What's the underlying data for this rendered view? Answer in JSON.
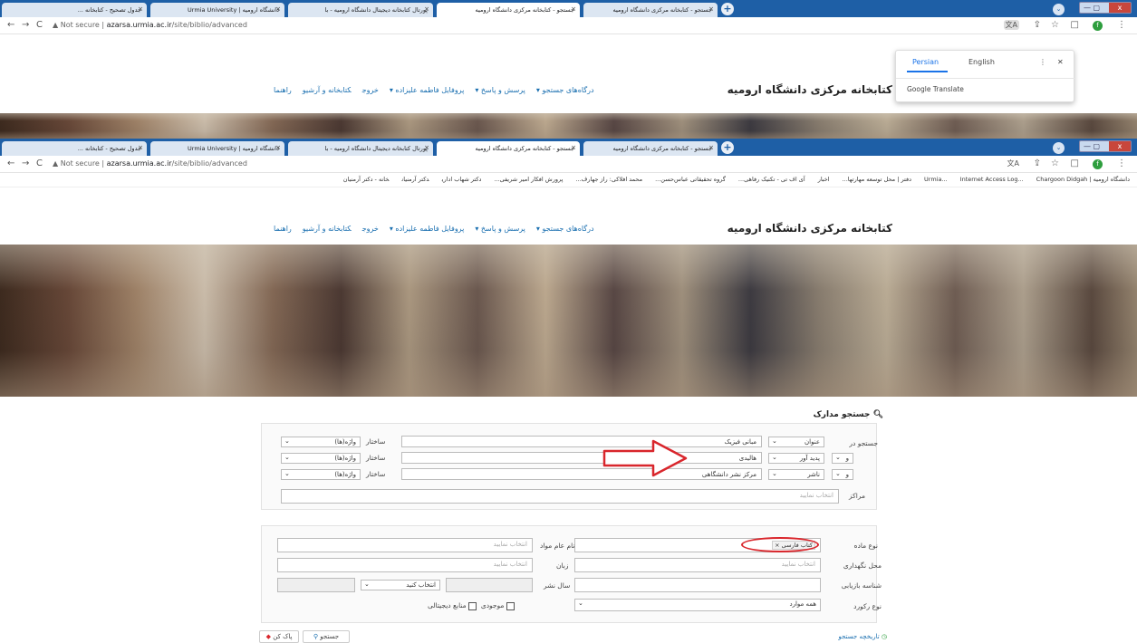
{
  "browser": {
    "tabs": [
      {
        "title": "جدول تصحیح - کتابخانه ...",
        "active": false
      },
      {
        "title": "دانشگاه ارومیه | Urmia University",
        "active": false
      },
      {
        "title": "پورتال کتابخانه دیجیتال دانشگاه ارومیه - با",
        "active": false
      },
      {
        "title": "جستجو - کتابخانه مرکزی دانشگاه ارومیه",
        "active": true
      },
      {
        "title": "جستجو - کتابخانه مرکزی دانشگاه ارومیه",
        "active": false
      }
    ],
    "new_tab_label": "+",
    "url_prefix": "Not secure",
    "url_host": "azarsa.urmia.ac.ir",
    "url_path": "/site/biblio/advanced",
    "bookmarks": [
      "دانشگاه ارومیه | Urmia...",
      "Internet Access Log...",
      "Chargoon Didgah",
      "دفتر | محل توسعه مهارتها...",
      "اخبار",
      "آی اف تی - تکنیک رفاهی...",
      "گروه تحقیقاتی عباس‌حسن...",
      "محمد افلاکی: راز جهارف...",
      "پرورش افکار امیر شریفی...",
      "دکتر شهاب اداری",
      "دکتر آرمنیان",
      "خانه - دکتر آرمنیان"
    ],
    "avatar_letter": "f"
  },
  "translate_popup": {
    "tab_persian": "Persian",
    "tab_english": "English",
    "footer": "Google Translate"
  },
  "site": {
    "name": "کتابخانه مرکزی دانشگاه ارومیه",
    "menu": [
      "درگاه‌های جستجو ▾",
      "پرسش و پاسخ ▾",
      "پروفایل فاطمه علیزاده ▾",
      "خروج",
      "کتابخانه و آرشیو",
      "راهنما"
    ]
  },
  "form": {
    "title": "جستجو مدارک",
    "search_in_label": "جستجو در",
    "rows": [
      {
        "op": "",
        "field": "عنوان",
        "value": "مبانی فیزیک",
        "structure_label": "ساختار",
        "structure": "واژه(ها)"
      },
      {
        "op": "و",
        "field": "پدید آور",
        "value": "هالیدی",
        "structure_label": "ساختار",
        "structure": "واژه(ها)"
      },
      {
        "op": "و",
        "field": "ناشر",
        "value": "مرکز نشر دانشگاهی",
        "structure_label": "ساختار",
        "structure": "واژه(ها)"
      }
    ],
    "centers_label": "مراکز",
    "centers_placeholder": "انتخاب نمایید",
    "material_type_label": "نوع ماده",
    "material_chip": "کتاب فارسی ×",
    "general_material_label": "نام عام مواد",
    "general_material_placeholder": "انتخاب نمایید",
    "location_label": "محل نگهداری",
    "location_placeholder": "انتخاب نمایید",
    "language_label": "زبان",
    "language_placeholder": "انتخاب نمایید",
    "retrieval_id_label": "شناسه بازیابی",
    "pub_year_label": "سال نشر",
    "choose_label": "انتخاب کنید",
    "record_type_label": "نوع رکورد",
    "record_type_value": "همه موارد",
    "available_label": "موجودی",
    "digital_label": "منابع دیجیتالی",
    "search_button": "جستجو",
    "clear_button": "پاک کن",
    "history_link": "تاریخچه جستجو"
  },
  "colors": {
    "tabstrip": "#1e5fa6",
    "link": "#1a6fb0",
    "annotation": "#d9262c"
  }
}
